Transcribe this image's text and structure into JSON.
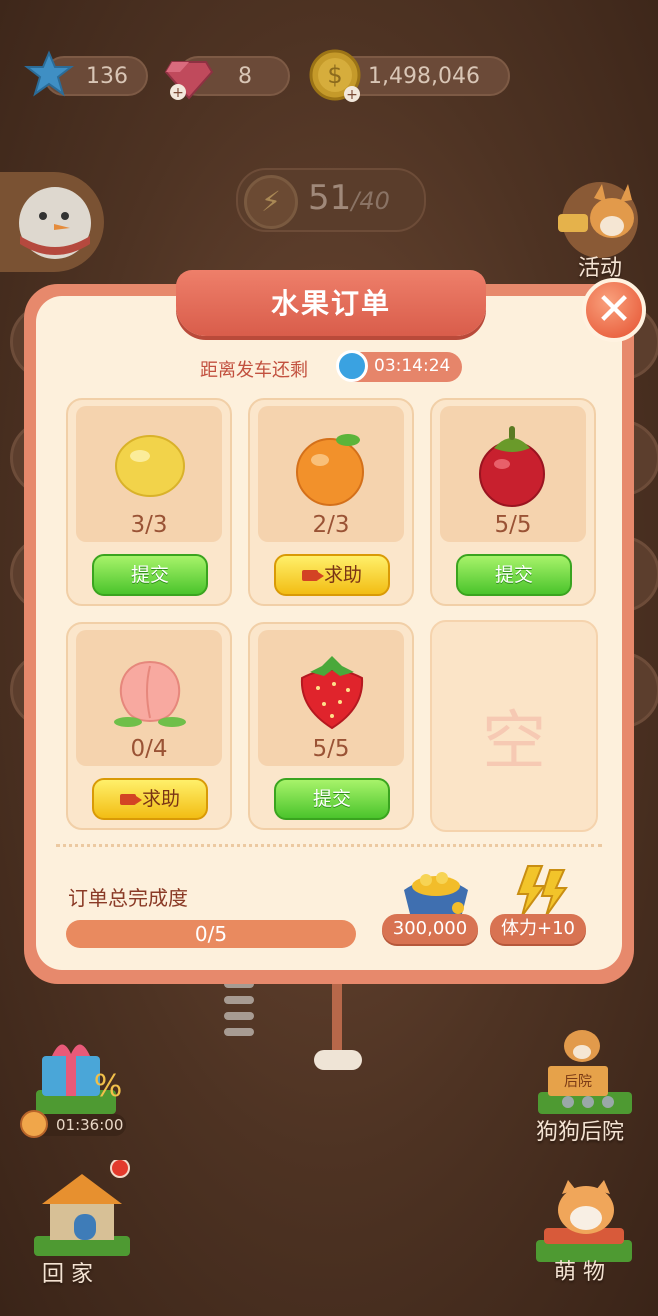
{
  "currency": {
    "gems": "136",
    "diamonds": "8",
    "coins": "1,498,046"
  },
  "energy": {
    "current": "51",
    "max": "/40"
  },
  "side": {
    "activity_label": "活动"
  },
  "modal": {
    "title": "水果订单",
    "countdown_label": "距离发车还剩",
    "countdown_time": "03:14:24",
    "orders": [
      {
        "fruit": "lemon",
        "count": "3/3",
        "action": "提交",
        "action_type": "submit"
      },
      {
        "fruit": "orange",
        "count": "2/3",
        "action": "求助",
        "action_type": "help"
      },
      {
        "fruit": "mangosteen",
        "count": "5/5",
        "action": "提交",
        "action_type": "submit"
      },
      {
        "fruit": "peach",
        "count": "0/4",
        "action": "求助",
        "action_type": "help"
      },
      {
        "fruit": "strawberry",
        "count": "5/5",
        "action": "提交",
        "action_type": "submit"
      }
    ],
    "empty_slot": "空",
    "progress_label": "订单总完成度",
    "progress_text": "0/5",
    "progress_value": 0,
    "reward_coins": "300,000",
    "reward_energy": "体力+10"
  },
  "bottom": {
    "gift_timer": "01:36:00",
    "dog_yard": "狗狗后院",
    "dog_yard_sign": "后院",
    "home": "回 家",
    "pets": "萌 物"
  },
  "colors": {
    "accent": "#e2644e",
    "submit": "#4bc42c",
    "help": "#f2bd14",
    "panel": "#fdf0dc"
  }
}
